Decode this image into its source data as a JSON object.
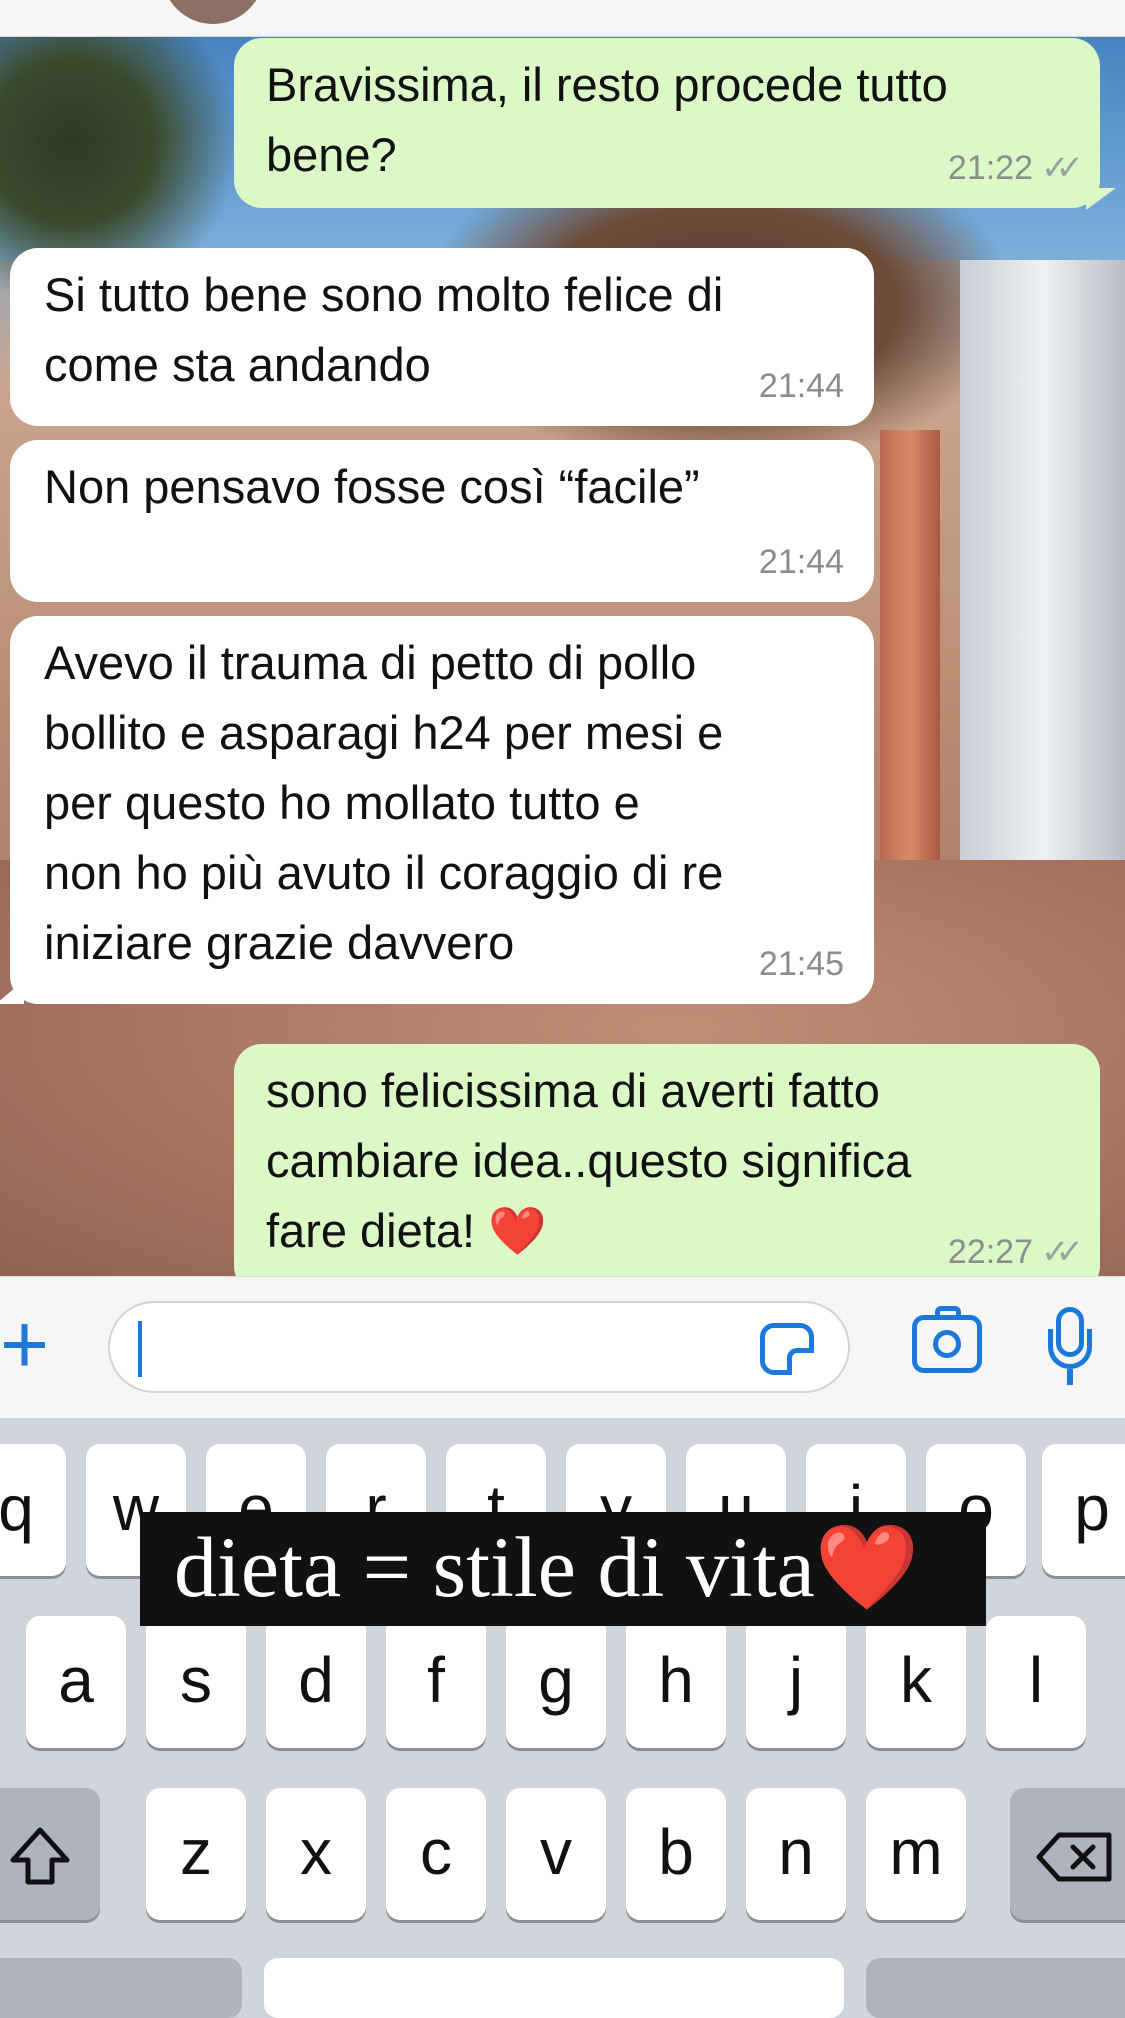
{
  "colors": {
    "outgoing_bubble": "#dcf8c6",
    "incoming_bubble": "#ffffff",
    "accent": "#1a79d9",
    "keyboard_bg": "#d1d4db"
  },
  "messages": [
    {
      "direction": "outgoing",
      "text": "Bravissima, il resto procede tutto\nbene?",
      "time": "21:22",
      "status": "read"
    },
    {
      "direction": "incoming",
      "text": "Si tutto bene sono molto felice di\ncome sta andando",
      "time": "21:44"
    },
    {
      "direction": "incoming",
      "text": "Non pensavo fosse così “facile”",
      "time": "21:44"
    },
    {
      "direction": "incoming",
      "text": "Avevo il trauma di petto di pollo\nbollito e asparagi h24 per mesi e\nper questo ho mollato tutto e\nnon ho più avuto il coraggio di re\niniziare grazie davvero",
      "time": "21:45"
    },
    {
      "direction": "outgoing",
      "text": "sono felicissima di averti fatto\ncambiare idea..questo significa\nfare dieta!",
      "emoji": "❤️",
      "time": "22:27",
      "status": "read"
    }
  ],
  "input": {
    "value": "",
    "icons": [
      "plus-icon",
      "sticker-icon",
      "camera-icon",
      "microphone-icon"
    ]
  },
  "overlay": {
    "text": "dieta = stile di vita",
    "emoji": "❤️"
  },
  "keyboard": {
    "row1": [
      "q",
      "w",
      "e",
      "r",
      "t",
      "y",
      "u",
      "i",
      "o",
      "p"
    ],
    "row2": [
      "a",
      "s",
      "d",
      "f",
      "g",
      "h",
      "j",
      "k",
      "l"
    ],
    "row3": [
      "z",
      "x",
      "c",
      "v",
      "b",
      "n",
      "m"
    ],
    "shift_icon": "shift-icon",
    "delete_icon": "backspace-icon"
  }
}
